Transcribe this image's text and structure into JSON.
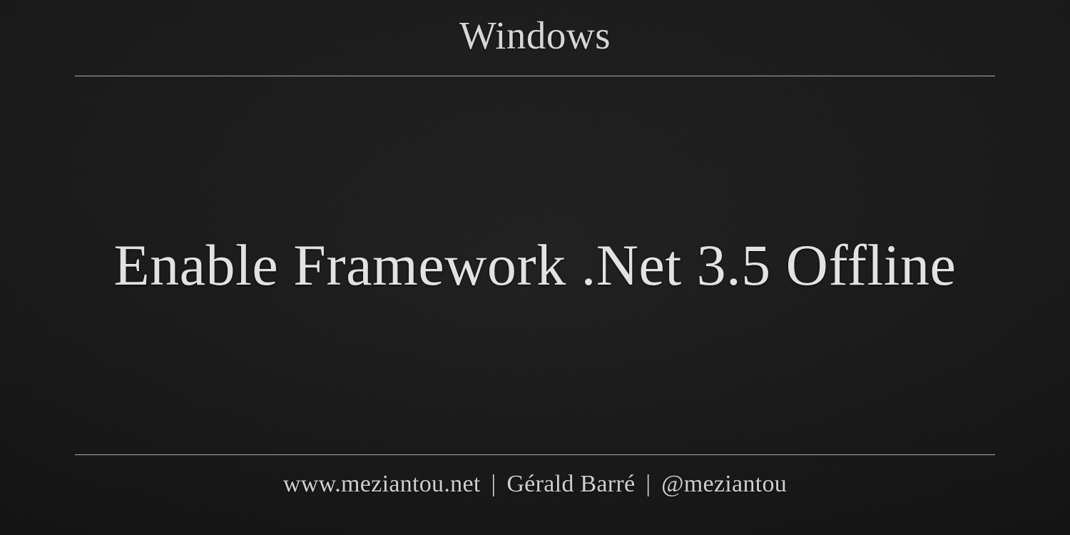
{
  "header": {
    "category": "Windows"
  },
  "main": {
    "title": "Enable Framework .Net 3.5 Offline"
  },
  "footer": {
    "website": "www.meziantou.net",
    "author": "Gérald Barré",
    "handle": "@meziantou",
    "separator": "|"
  }
}
